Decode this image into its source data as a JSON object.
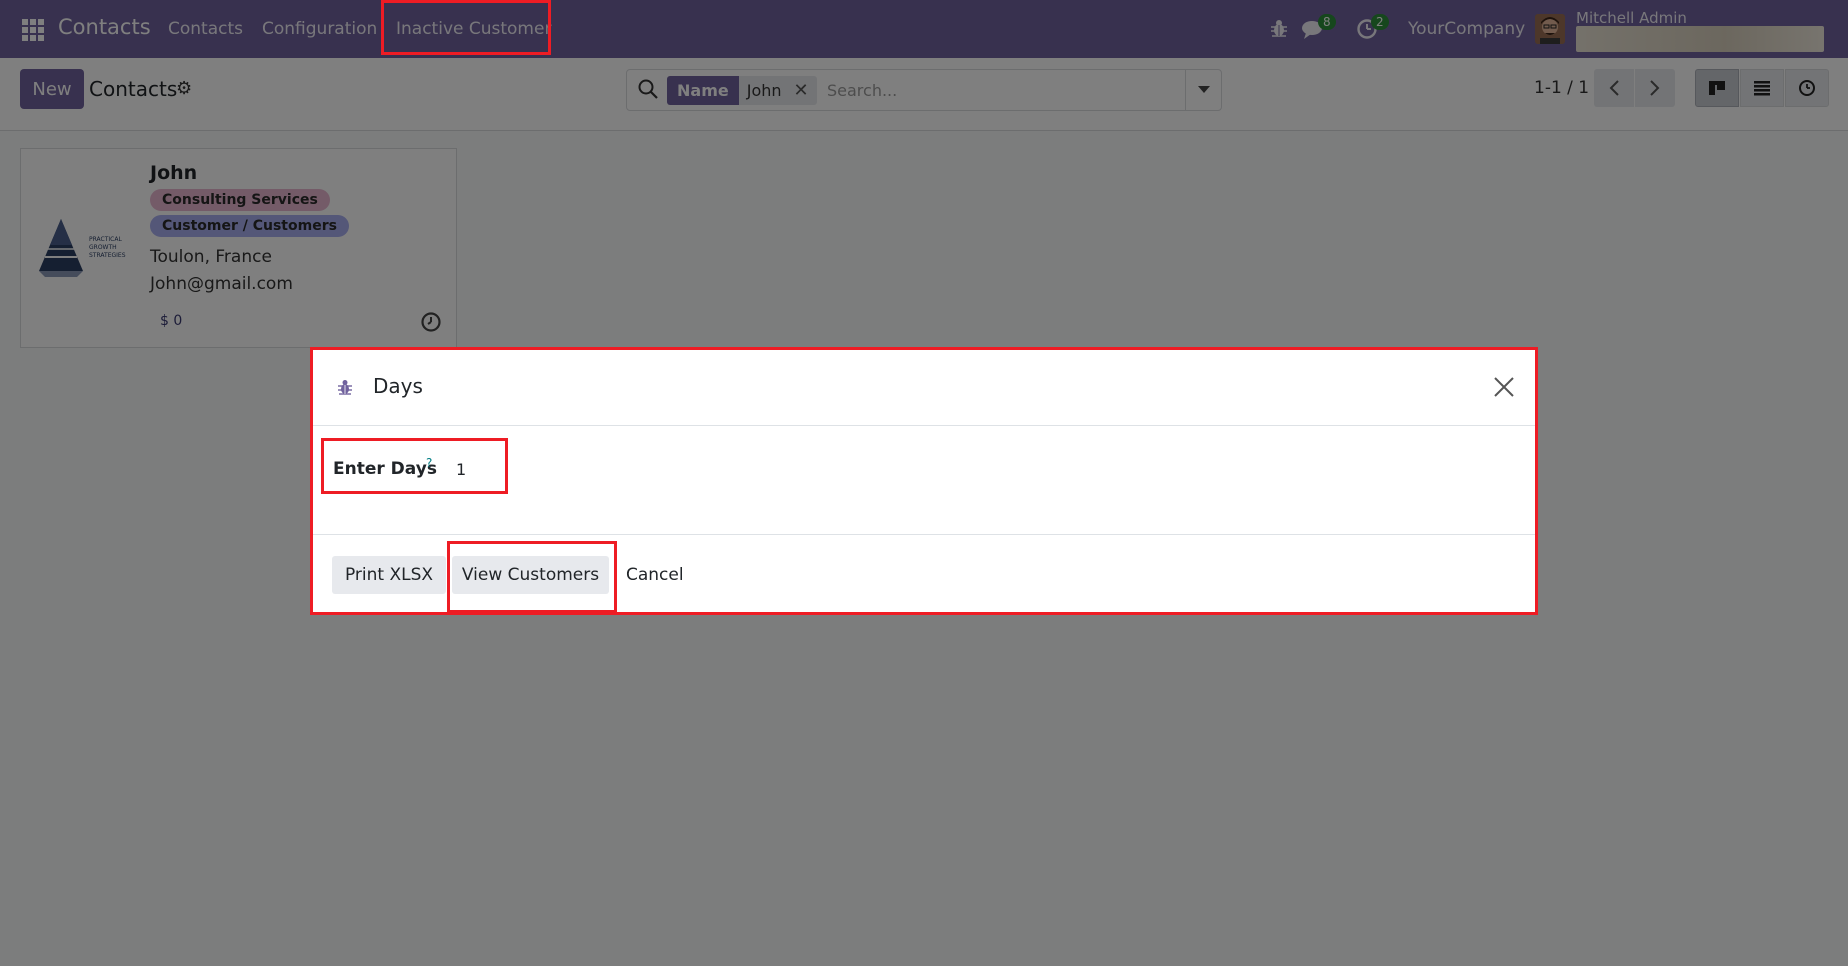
{
  "navbar": {
    "brand": "Contacts",
    "menu": [
      "Contacts",
      "Configuration",
      "Inactive Customer"
    ],
    "messages_count": "8",
    "activities_count": "2",
    "company": "YourCompany",
    "user": "Mitchell Admin"
  },
  "control": {
    "new_label": "New",
    "title": "Contacts",
    "search": {
      "facet_label": "Name",
      "facet_value": "John",
      "placeholder": "Search..."
    },
    "pager": "1-1 / 1"
  },
  "card": {
    "name": "John",
    "tags": [
      "Consulting Services",
      "Customer / Customers"
    ],
    "location": "Toulon, France",
    "email": "John@gmail.com",
    "amount": "$ 0"
  },
  "modal": {
    "title": "Days",
    "field_label": "Enter Days",
    "field_help": "?",
    "field_value": "1",
    "buttons": {
      "print": "Print XLSX",
      "view": "View Customers",
      "cancel": "Cancel"
    }
  },
  "colors": {
    "brand": "#71639e",
    "annotation": "#ee1c24",
    "tag_pink": "#e9b7d1",
    "tag_blue": "#a9aff0"
  }
}
